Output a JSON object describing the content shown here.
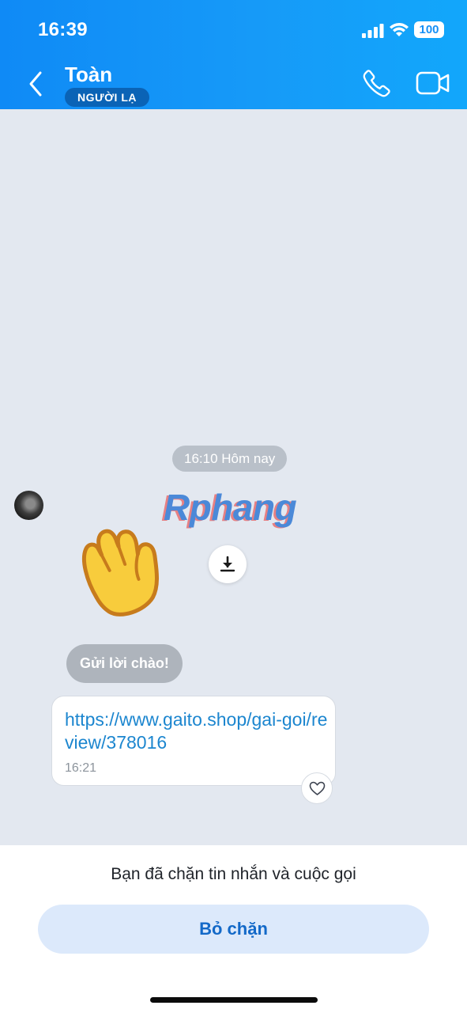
{
  "status_bar": {
    "time": "16:39",
    "battery": "100"
  },
  "header": {
    "contact_name": "Toàn",
    "badge": "NGƯỜI LẠ",
    "back_icon": "chevron-left-icon",
    "call_icon": "phone-icon",
    "video_icon": "video-camera-icon",
    "background": "#169af8"
  },
  "chat": {
    "date_separator": "16:10 Hôm nay",
    "watermark": "Rphang",
    "sticker_icon": "waving-hand-icon",
    "download_icon": "download-icon",
    "greeting_label": "Gửi lời chào!",
    "message": {
      "text": "https://www.gaito.shop/gai-goi/review/378016",
      "time": "16:21"
    },
    "react_icon": "heart-icon"
  },
  "footer": {
    "blocked_notice": "Bạn đã chặn tin nhắn và cuộc gọi",
    "unblock_label": "Bỏ chặn"
  },
  "colors": {
    "header_blue": "#169af8",
    "chat_background": "#e3e8f0",
    "link_blue": "#1c86cf",
    "button_background": "#dce9fb",
    "button_text": "#1369c8"
  }
}
